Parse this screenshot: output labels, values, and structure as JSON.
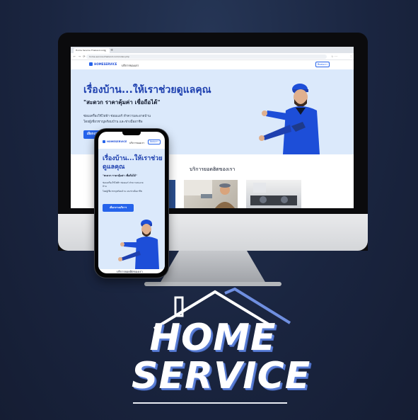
{
  "browser": {
    "tab_title": "Home Service Thailand.com",
    "tab_close": "×",
    "tab_new": "+",
    "nav_icons": "← → ⟳",
    "url": "home-service-thailand.com/index.php",
    "extension_icons": "☆ ⋯",
    "menu_icon": "⋮"
  },
  "site": {
    "logo_text": "HOMESERVICE",
    "menu_services": "บริการของเรา",
    "contact_button": "ติดต่อเรา",
    "hero_title": "เรื่องบ้าน...ให้เราช่วยดูแลคุณ",
    "hero_title_line1": "เรื่องบ้าน...ให้เราช่วย",
    "hero_title_line2": "ดูแลคุณ",
    "hero_subtitle": "\"สะดวก ราคาคุ้มค่า เชื่อถือได้\"",
    "hero_desc_line1": "ซ่อมเครื่องใช้ไฟฟ้า ซ่อมแอร์ ทำความสะอาดบ้าน",
    "hero_desc_line2": "โดยผู้เชี่ยวชาญพร้อมบ้าน และช่างมืออาชีพ",
    "cta_button": "เลือกงานบริการ",
    "section_title": "บริการยอดฮิตของเรา"
  },
  "brand": {
    "line1": "HOME",
    "line2": "SERVICE"
  },
  "colors": {
    "background": "#1a2540",
    "accent": "#2563eb",
    "hero_bg": "#dbe9fb",
    "brand_shadow": "#5b7fd6"
  }
}
